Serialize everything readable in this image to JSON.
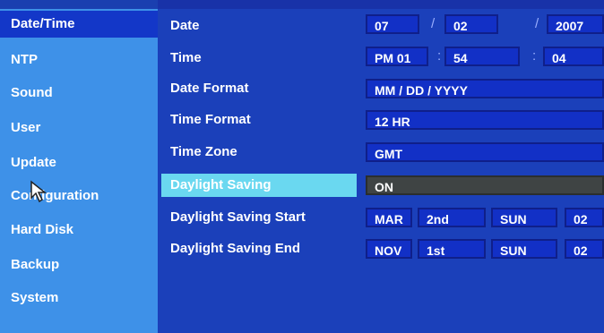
{
  "sidebar": {
    "items": [
      {
        "label": "Date/Time",
        "selected": true
      },
      {
        "label": "NTP"
      },
      {
        "label": "Sound"
      },
      {
        "label": "User"
      },
      {
        "label": "Update"
      },
      {
        "label": "Configuration"
      },
      {
        "label": "Hard Disk"
      },
      {
        "label": "Backup"
      },
      {
        "label": "System"
      }
    ]
  },
  "settings": {
    "date": {
      "label": "Date",
      "month": "07",
      "day": "02",
      "year": "2007",
      "sep": "/"
    },
    "time": {
      "label": "Time",
      "hour": "PM 01",
      "minute": "54",
      "second": "04",
      "sep": ":"
    },
    "date_format": {
      "label": "Date Format",
      "value": "MM / DD / YYYY"
    },
    "time_format": {
      "label": "Time Format",
      "value": "12 HR"
    },
    "time_zone": {
      "label": "Time Zone",
      "value": "GMT"
    },
    "daylight_saving": {
      "label": "Daylight Saving",
      "value": "ON"
    },
    "dst_start": {
      "label": "Daylight Saving Start",
      "month": "MAR",
      "week": "2nd",
      "day": "SUN",
      "hour": "02"
    },
    "dst_end": {
      "label": "Daylight Saving End",
      "month": "NOV",
      "week": "1st",
      "day": "SUN",
      "hour": "02"
    }
  },
  "colors": {
    "sidebar": "#3e91e8",
    "main": "#1b40ba",
    "highlight": "#6ad8f0",
    "selected_item": "#1337c8"
  }
}
